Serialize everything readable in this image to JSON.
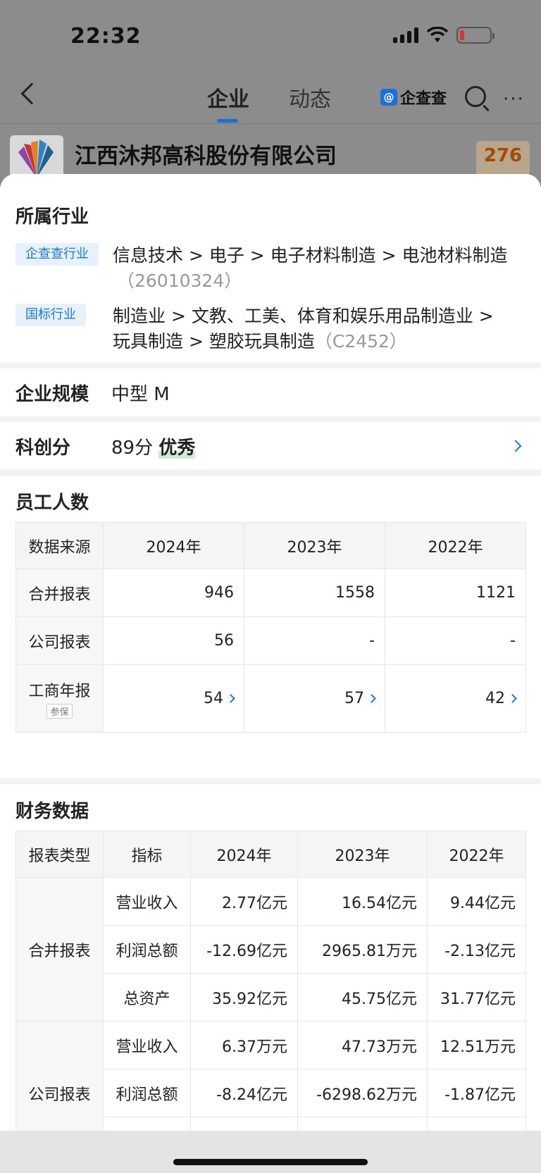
{
  "status_bar": {
    "time": "22:32"
  },
  "nav": {
    "tabs": [
      {
        "label": "企业"
      },
      {
        "label": "动态"
      }
    ],
    "brand": "企查查"
  },
  "company": {
    "name": "江西沐邦高科股份有限公司",
    "score": "276"
  },
  "industry": {
    "title": "所属行业",
    "qcc_tag": "企查查行业",
    "qcc_path": "信息技术 > 电子 > 电子材料制造 > 电池材料制造",
    "qcc_code": "（26010324）",
    "gb_tag": "国标行业",
    "gb_path_line1": "制造业 > 文教、工美、体育和娱乐用品制造业 >",
    "gb_path_line2": "玩具制造 > 塑胶玩具制造",
    "gb_code": "（C2452）"
  },
  "scale": {
    "label": "企业规模",
    "value": "中型 M"
  },
  "tech_score": {
    "label": "科创分",
    "value": "89分",
    "grade": "优秀"
  },
  "employees": {
    "title": "员工人数",
    "header": [
      "数据来源",
      "2024年",
      "2023年",
      "2022年"
    ],
    "rows": [
      {
        "source": "合并报表",
        "values": [
          "946",
          "1558",
          "1121"
        ]
      },
      {
        "source": "公司报表",
        "values": [
          "56",
          "-",
          "-"
        ]
      },
      {
        "source": "工商年报",
        "tag": "参保",
        "values": [
          "54",
          "57",
          "42"
        ]
      }
    ]
  },
  "finance": {
    "title": "财务数据",
    "header": [
      "报表类型",
      "指标",
      "2024年",
      "2023年",
      "2022年"
    ],
    "groups": [
      {
        "type": "合并报表",
        "rows": [
          {
            "metric": "营业收入",
            "values": [
              "2.77亿元",
              "16.54亿元",
              "9.44亿元"
            ]
          },
          {
            "metric": "利润总额",
            "values": [
              "-12.69亿元",
              "2965.81万元",
              "-2.13亿元"
            ]
          },
          {
            "metric": "总资产",
            "values": [
              "35.92亿元",
              "45.75亿元",
              "31.77亿元"
            ]
          }
        ]
      },
      {
        "type": "公司报表",
        "rows": [
          {
            "metric": "营业收入",
            "values": [
              "6.37万元",
              "47.73万元",
              "12.51万元"
            ]
          },
          {
            "metric": "利润总额",
            "values": [
              "-8.24亿元",
              "-6298.62万元",
              "-1.87亿元"
            ]
          }
        ]
      }
    ]
  }
}
